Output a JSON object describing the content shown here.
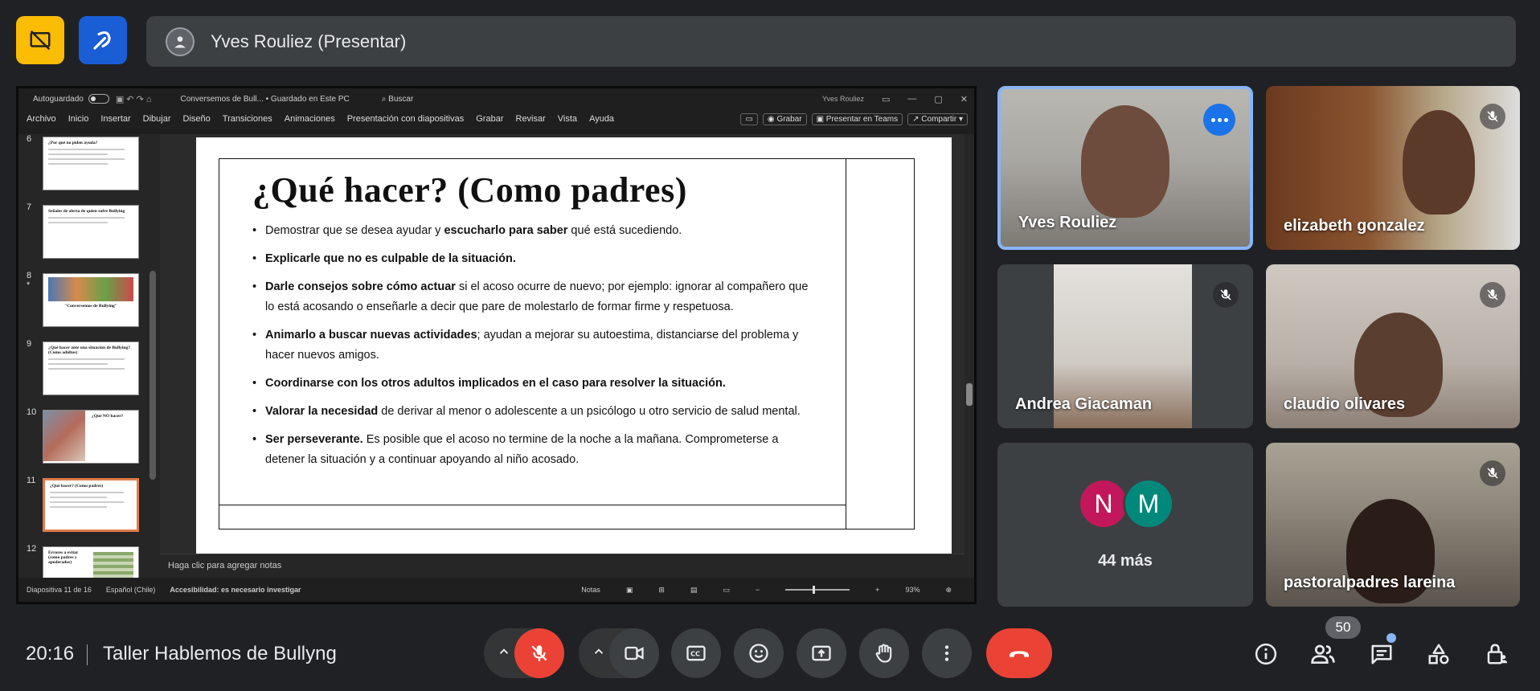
{
  "presenter": {
    "label": "Yves Rouliez (Presentar)"
  },
  "ppt": {
    "autosave": "Autoguardado",
    "doc_title": "Conversemos de Bull... • Guardado en Este PC",
    "search": "Buscar",
    "user": "Yves Rouliez",
    "menu": [
      "Archivo",
      "Inicio",
      "Insertar",
      "Dibujar",
      "Diseño",
      "Transiciones",
      "Animaciones",
      "Presentación con diapositivas",
      "Grabar",
      "Revisar",
      "Vista",
      "Ayuda"
    ],
    "actions": {
      "record": "Grabar",
      "teams": "Presentar en Teams",
      "share": "Compartir"
    },
    "thumbnails": [
      {
        "num": "6",
        "title": "¿Por qué no piden ayuda?"
      },
      {
        "num": "7",
        "title": "Señales de alerta de quien sufre Bullying"
      },
      {
        "num": "8",
        "title": "\"Conversemos de Bullying\"",
        "star": "*"
      },
      {
        "num": "9",
        "title": "¿Qué hacer ante una situación de Bullying? (Como adultos)"
      },
      {
        "num": "10",
        "title": "¿Qué NO hacer?"
      },
      {
        "num": "11",
        "title": "¿Qué hacer? (Como padres)"
      },
      {
        "num": "12",
        "title": "Errores a evitar (como padres y apoderados)"
      }
    ],
    "notes": "Haga clic para agregar notas",
    "status": {
      "slide": "Diapositiva 11 de 16",
      "lang": "Español (Chile)",
      "access": "Accesibilidad: es necesario investigar",
      "notes_btn": "Notas",
      "zoom": "93%"
    }
  },
  "slide": {
    "title": "¿Qué hacer? (Como padres)",
    "bullets": [
      {
        "parts": [
          {
            "t": "Demostrar que se desea ayudar y ",
            "b": false
          },
          {
            "t": "escucharlo para saber",
            "b": true
          },
          {
            "t": " qué está sucediendo.",
            "b": false
          }
        ]
      },
      {
        "parts": [
          {
            "t": "Explicarle que no es culpable de la situación.",
            "b": true
          }
        ]
      },
      {
        "parts": [
          {
            "t": "Darle consejos sobre cómo actuar",
            "b": true
          },
          {
            "t": " si el acoso ocurre de nuevo; por ejemplo: ignorar al compañero que lo está acosando o enseñarle a decir que pare de molestarlo de formar firme y respetuosa.",
            "b": false
          }
        ]
      },
      {
        "parts": [
          {
            "t": "Animarlo a buscar nuevas actividades",
            "b": true
          },
          {
            "t": "; ayudan a mejorar su autoestima, distanciarse del problema y hacer nuevos amigos.",
            "b": false
          }
        ]
      },
      {
        "parts": [
          {
            "t": "Coordinarse con los otros adultos implicados en el caso para resolver la situación.",
            "b": true
          }
        ]
      },
      {
        "parts": [
          {
            "t": "Valorar la necesidad",
            "b": true
          },
          {
            "t": " de derivar al menor o adolescente a un psicólogo u otro servicio de salud mental.",
            "b": false
          }
        ]
      },
      {
        "parts": [
          {
            "t": "Ser perseverante.",
            "b": true
          },
          {
            "t": " Es posible que el acoso no termine de la noche a la mañana. Comprometerse a detener la situación y a continuar apoyando al niño acosado.",
            "b": false
          }
        ]
      }
    ]
  },
  "participants": {
    "p1": "Yves Rouliez",
    "p2": "elizabeth gonzalez",
    "p3": "Andrea Giacaman",
    "p4": "claudio olivares",
    "more_initials": [
      "N",
      "M"
    ],
    "more_label": "44 más",
    "p6": "pastoralpadres lareina"
  },
  "bottom": {
    "time": "20:16",
    "meeting_name": "Taller Hablemos de Bullyng",
    "people_count": "50"
  },
  "colors": {
    "accent": "#8ab4f8",
    "end_call": "#ea4335",
    "mute": "#ea4335",
    "yellow_btn": "#fbbc04",
    "blue_btn": "#1a5ed6"
  }
}
